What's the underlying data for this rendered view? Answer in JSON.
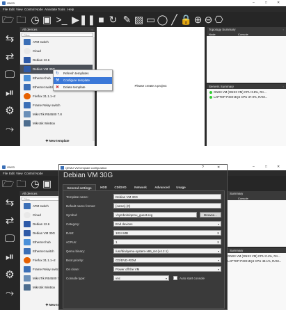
{
  "window": {
    "title": "GNS3",
    "controls": {
      "minimize": "–",
      "maximize": "□",
      "close": "✕"
    }
  },
  "menu": [
    "File",
    "Edit",
    "View",
    "Control",
    "Node",
    "Annotate",
    "Tools",
    "Help"
  ],
  "toolbar_icons": [
    "folder-icon",
    "play-icon",
    "terminal-icon",
    "stop-icon",
    "pause-icon",
    "reload-icon",
    "note-icon",
    "image-icon",
    "rectangle-icon",
    "ellipse-icon",
    "line-icon",
    "lock-icon",
    "zoom-in-icon",
    "zoom-out-icon",
    "screenshot-icon"
  ],
  "rail_icons": [
    "router-icon",
    "switch-icon",
    "end-device-icon",
    "security-icon",
    "all-devices-icon",
    "link-icon"
  ],
  "device_panel": {
    "title": "All devices",
    "filter_placeholder": "Filter",
    "items": [
      {
        "label": "ATM switch",
        "color": "#3b6fb6"
      },
      {
        "label": "Cloud",
        "color": "#e8e8e8"
      },
      {
        "label": "Debian 12.6",
        "color": "#2e5aa7"
      },
      {
        "label": "Debian VM 30G",
        "color": "#2e5aa7"
      },
      {
        "label": "Ethernet hub",
        "color": "#4a90d9"
      },
      {
        "label": "Ethernet switch",
        "color": "#3b6fb6"
      },
      {
        "label": "Firefox 31.1.1~2",
        "color": "#e66000"
      },
      {
        "label": "Frame Relay switch",
        "color": "#3b6fb6"
      },
      {
        "label": "MikroTik RB4500 7.8",
        "color": "#6a8fb8"
      },
      {
        "label": "Mikrotik WinBox",
        "color": "#4d6d8e"
      }
    ],
    "new_template": "New template"
  },
  "canvas": {
    "message": "Please create a project"
  },
  "topology": {
    "title": "Topology Summary",
    "col_node": "Node",
    "col_console": "Console"
  },
  "servers": {
    "title": "Servers Summary",
    "entries": [
      "GNS3 VM (GNS3 VM) CPU 3.8%, RA...",
      "LAPTOP-P3OH4Q4 CPU 37.9%, RAM..."
    ],
    "entries_shot2": [
      "GNS3 VM (GNS3 VM) CPU 0.4%, RA...",
      "LAPTOP-P3OH4Q4 CPU 48.1%, RAM..."
    ],
    "header_shot2": "Summary",
    "console_shot2": "Console"
  },
  "context_menu": {
    "items": [
      {
        "label": "Refresh templates",
        "icon": "refresh-icon"
      },
      {
        "label": "Configure template",
        "icon": "configure-icon"
      },
      {
        "label": "Delete template",
        "icon": "delete-icon"
      }
    ]
  },
  "dialog": {
    "window_title": "QEMU VM template configuration",
    "heading": "Debian VM 30G",
    "tabs": [
      "General settings",
      "HDD",
      "CD/DVD",
      "Network",
      "Advanced",
      "Usage"
    ],
    "fields": {
      "template_name_label": "Template name:",
      "template_name_value": "Debian VM 30G",
      "default_name_label": "Default name format:",
      "default_name_value": "{name}-{0}",
      "symbol_label": "Symbol:",
      "symbol_value": ":/symbols/qemu_guest.svg",
      "browse": "Browse...",
      "category_label": "Category:",
      "category_value": "End devices",
      "ram_label": "RAM:",
      "ram_value": "1024 MB",
      "vcpus_label": "vCPUs:",
      "vcpus_value": "1",
      "qemu_binary_label": "Qemu binary:",
      "qemu_binary_value": "/usr/bin/qemu-system-x86_64 (v4.2.1)",
      "boot_priority_label": "Boot priority:",
      "boot_priority_value": "CD/DVD-ROM",
      "on_close_label": "On close:",
      "on_close_value": "Power off the VM",
      "console_type_label": "Console type:",
      "console_type_value": "vnc",
      "auto_start_console": "Auto start console"
    }
  },
  "colors": {
    "accent": "#3b78d8",
    "server_ok": "#33cc33"
  }
}
